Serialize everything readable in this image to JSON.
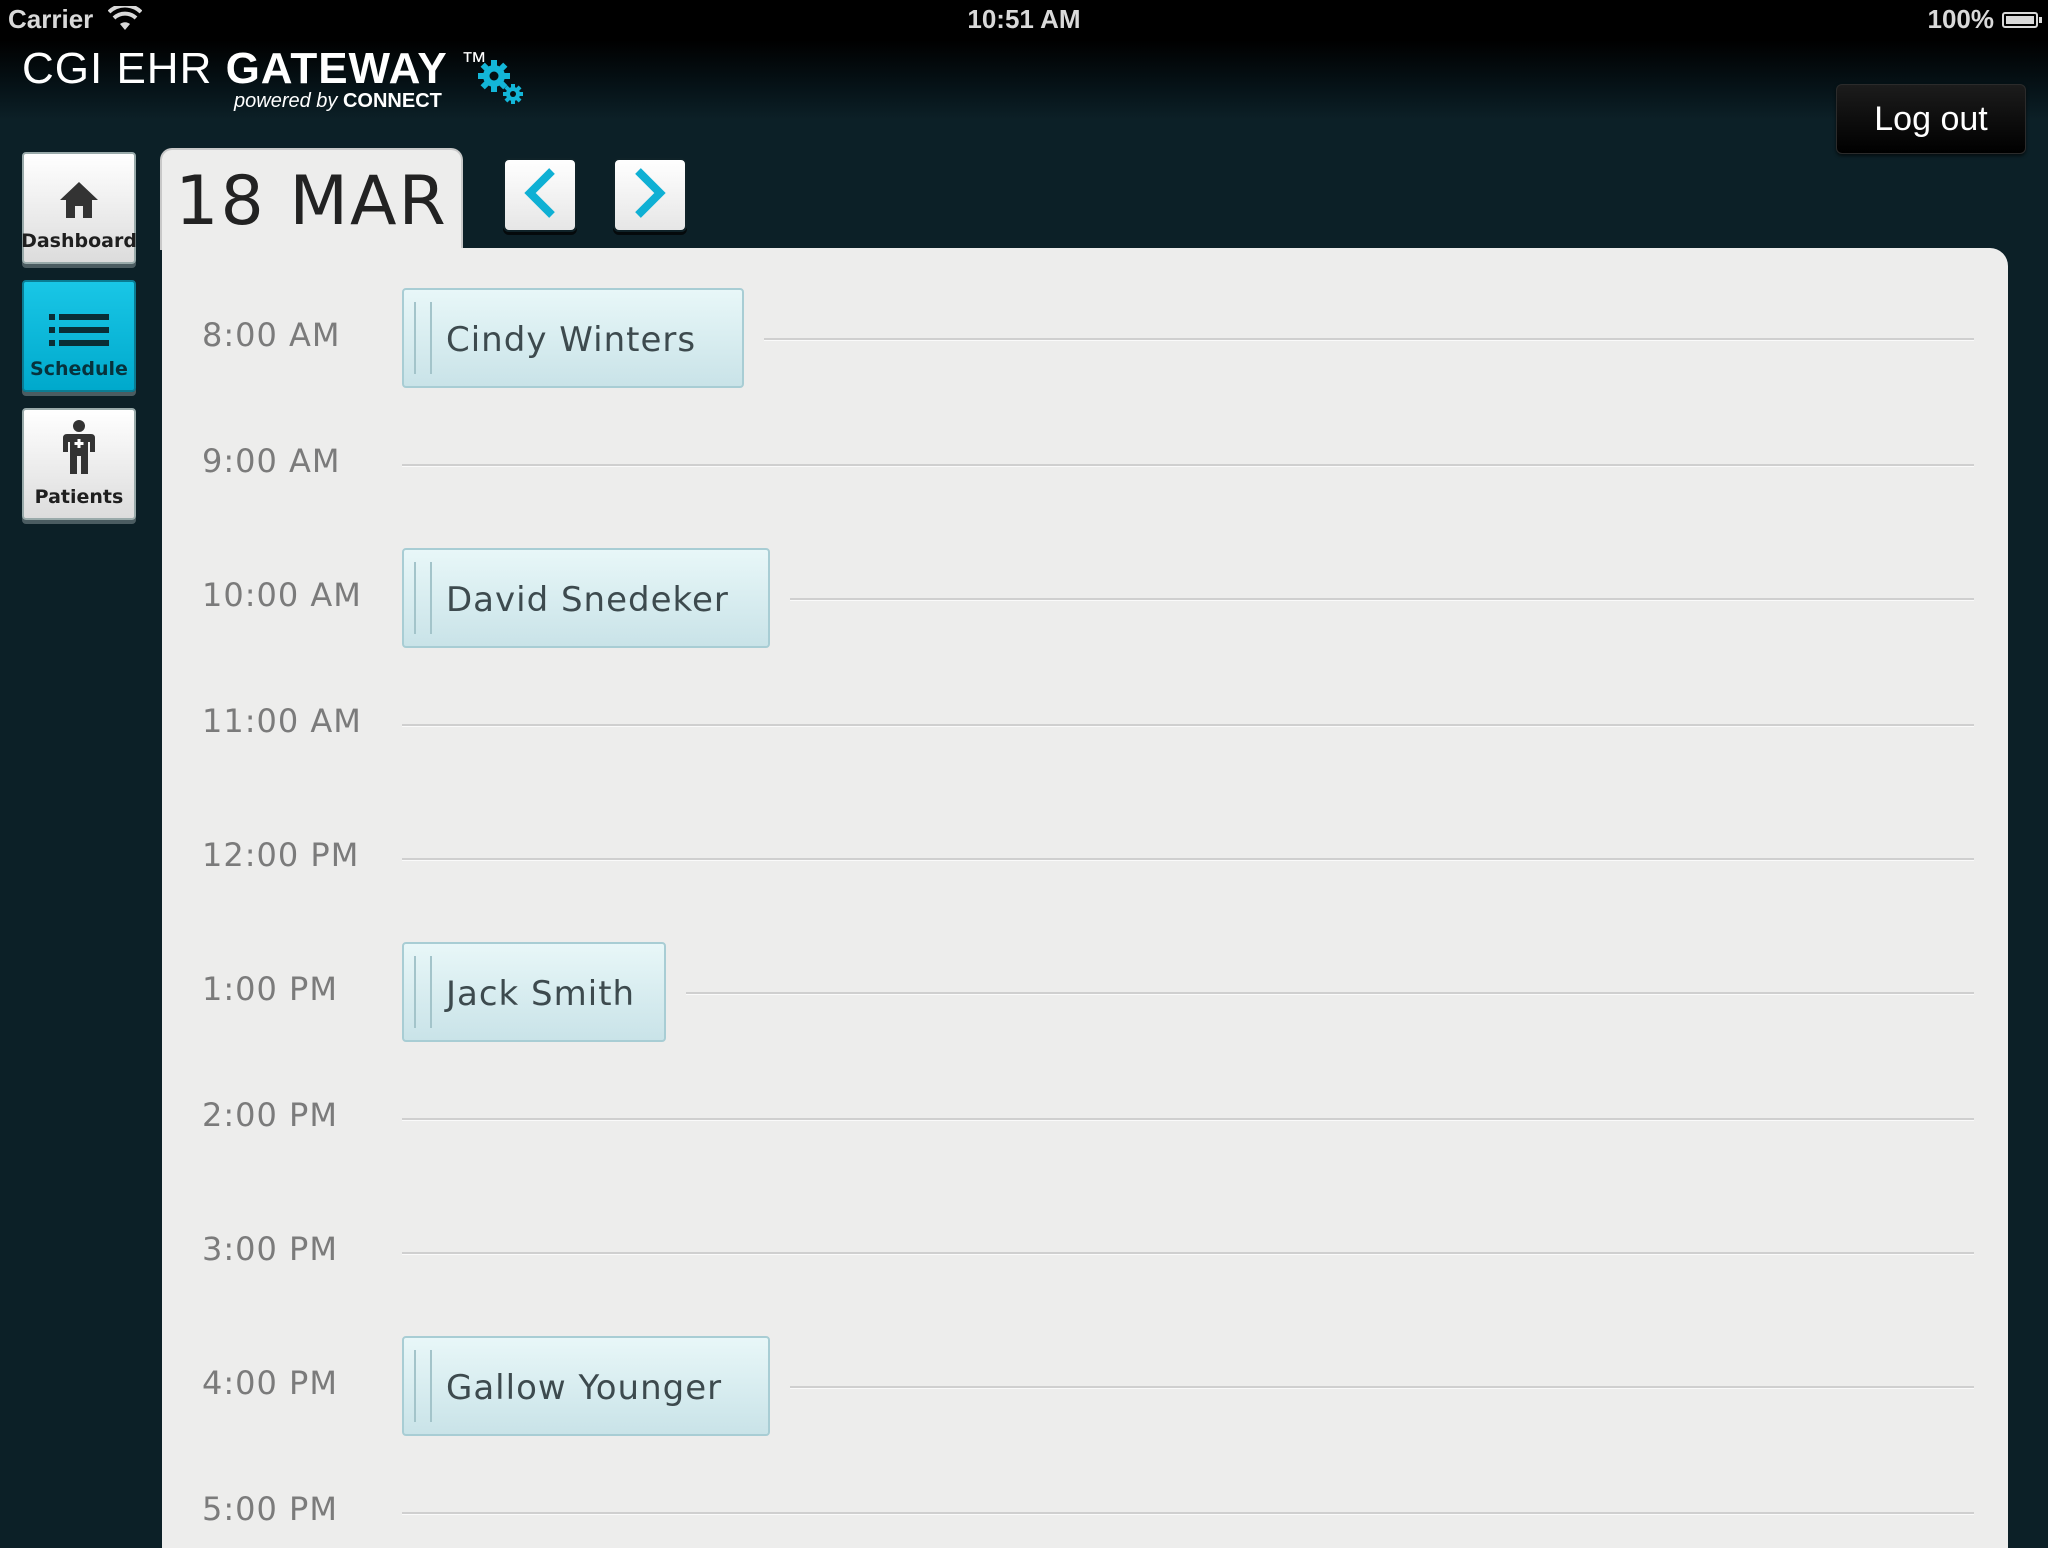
{
  "status_bar": {
    "carrier": "Carrier",
    "time": "10:51 AM",
    "battery": "100%"
  },
  "header": {
    "brand_light": "CGI EHR ",
    "brand_bold": "GATEWAY",
    "brand_tm": "™",
    "brand_sub_italic": "powered by ",
    "brand_sub_bold": "CONNECT",
    "logout_label": "Log out",
    "accent_color": "#13b6d8"
  },
  "nav": {
    "items": [
      {
        "label": "Dashboard",
        "icon": "home-icon",
        "active": false
      },
      {
        "label": "Schedule",
        "icon": "list-icon",
        "active": true
      },
      {
        "label": "Patients",
        "icon": "patient-icon",
        "active": false
      }
    ]
  },
  "schedule": {
    "date": "18 MAR",
    "slots": [
      {
        "time": "8:00 AM",
        "patient": "Cindy Winters"
      },
      {
        "time": "9:00 AM",
        "patient": ""
      },
      {
        "time": "10:00 AM",
        "patient": "David Snedeker"
      },
      {
        "time": "11:00 AM",
        "patient": ""
      },
      {
        "time": "12:00 PM",
        "patient": ""
      },
      {
        "time": "1:00 PM",
        "patient": "Jack Smith"
      },
      {
        "time": "2:00 PM",
        "patient": ""
      },
      {
        "time": "3:00 PM",
        "patient": ""
      },
      {
        "time": "4:00 PM",
        "patient": "Gallow Younger"
      },
      {
        "time": "5:00 PM",
        "patient": ""
      }
    ]
  }
}
